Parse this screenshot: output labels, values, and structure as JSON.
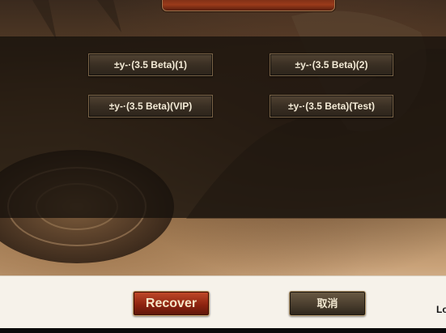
{
  "server_buttons": [
    {
      "label": "±y-·(3.5 Beta)(1)"
    },
    {
      "label": "±y-·(3.5 Beta)(2)"
    },
    {
      "label": "±y-·(3.5 Beta)(VIP)"
    },
    {
      "label": "±y-·(3.5 Beta)(Test)"
    }
  ],
  "footer": {
    "recover_label": "Recover",
    "cancel_label": "取消",
    "trailing_text": "Lo"
  },
  "colors": {
    "recover_button": "#8e2410",
    "cancel_button": "#4a3e2e",
    "overlay": "#16110c",
    "footer_bg": "#f6f2ea"
  }
}
